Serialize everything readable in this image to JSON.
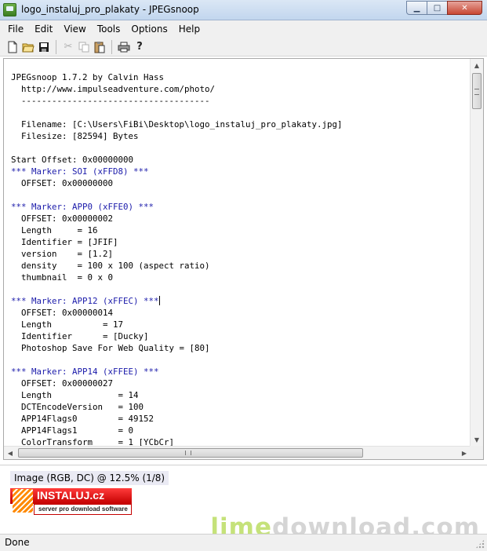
{
  "window": {
    "title": "logo_instaluj_pro_plakaty - JPEGsnoop",
    "min_label": "▁",
    "max_label": "□",
    "close_label": "✕"
  },
  "menu": [
    "File",
    "Edit",
    "View",
    "Tools",
    "Options",
    "Help"
  ],
  "toolbar": {
    "icons": [
      "new-doc-icon",
      "open-folder-icon",
      "save-disk-icon",
      "cut-icon",
      "copy-icon",
      "paste-icon",
      "print-icon",
      "help-icon"
    ]
  },
  "log": [
    {
      "text": "JPEGsnoop 1.7.2 by Calvin Hass",
      "marker": false
    },
    {
      "text": "  http://www.impulseadventure.com/photo/",
      "marker": false
    },
    {
      "text": "  -------------------------------------",
      "marker": false
    },
    {
      "text": "",
      "marker": false
    },
    {
      "text": "  Filename: [C:\\Users\\FiBi\\Desktop\\logo_instaluj_pro_plakaty.jpg]",
      "marker": false
    },
    {
      "text": "  Filesize: [82594] Bytes",
      "marker": false
    },
    {
      "text": "",
      "marker": false
    },
    {
      "text": "Start Offset: 0x00000000",
      "marker": false
    },
    {
      "text": "*** Marker: SOI (xFFD8) ***",
      "marker": true
    },
    {
      "text": "  OFFSET: 0x00000000",
      "marker": false
    },
    {
      "text": "",
      "marker": false
    },
    {
      "text": "*** Marker: APP0 (xFFE0) ***",
      "marker": true
    },
    {
      "text": "  OFFSET: 0x00000002",
      "marker": false
    },
    {
      "text": "  Length     = 16",
      "marker": false
    },
    {
      "text": "  Identifier = [JFIF]",
      "marker": false
    },
    {
      "text": "  version    = [1.2]",
      "marker": false
    },
    {
      "text": "  density    = 100 x 100 (aspect ratio)",
      "marker": false
    },
    {
      "text": "  thumbnail  = 0 x 0",
      "marker": false
    },
    {
      "text": "",
      "marker": false
    },
    {
      "text": "*** Marker: APP12 (xFFEC) ***",
      "marker": true,
      "caret": true
    },
    {
      "text": "  OFFSET: 0x00000014",
      "marker": false
    },
    {
      "text": "  Length          = 17",
      "marker": false
    },
    {
      "text": "  Identifier      = [Ducky]",
      "marker": false
    },
    {
      "text": "  Photoshop Save For Web Quality = [80]",
      "marker": false
    },
    {
      "text": "",
      "marker": false
    },
    {
      "text": "*** Marker: APP14 (xFFEE) ***",
      "marker": true
    },
    {
      "text": "  OFFSET: 0x00000027",
      "marker": false
    },
    {
      "text": "  Length             = 14",
      "marker": false
    },
    {
      "text": "  DCTEncodeVersion   = 100",
      "marker": false
    },
    {
      "text": "  APP14Flags0        = 49152",
      "marker": false
    },
    {
      "text": "  APP14Flags1        = 0",
      "marker": false
    },
    {
      "text": "  ColorTransform     = 1 [YCbCr]",
      "marker": false
    }
  ],
  "image_pane": {
    "caption": "Image (RGB, DC) @ 12.5% (1/8)",
    "logo_name": "INSTALUJ.cz",
    "logo_tagline": "server pro download software"
  },
  "watermark": {
    "part1": "lime",
    "part2": "download.com"
  },
  "status": "Done",
  "colors": {
    "marker_text": "#1a1aaa",
    "titlebar": "#c2d6ee",
    "chrome": "#f0f0f0",
    "close_button": "#c84733",
    "watermark_lime": "#c5e27a"
  }
}
